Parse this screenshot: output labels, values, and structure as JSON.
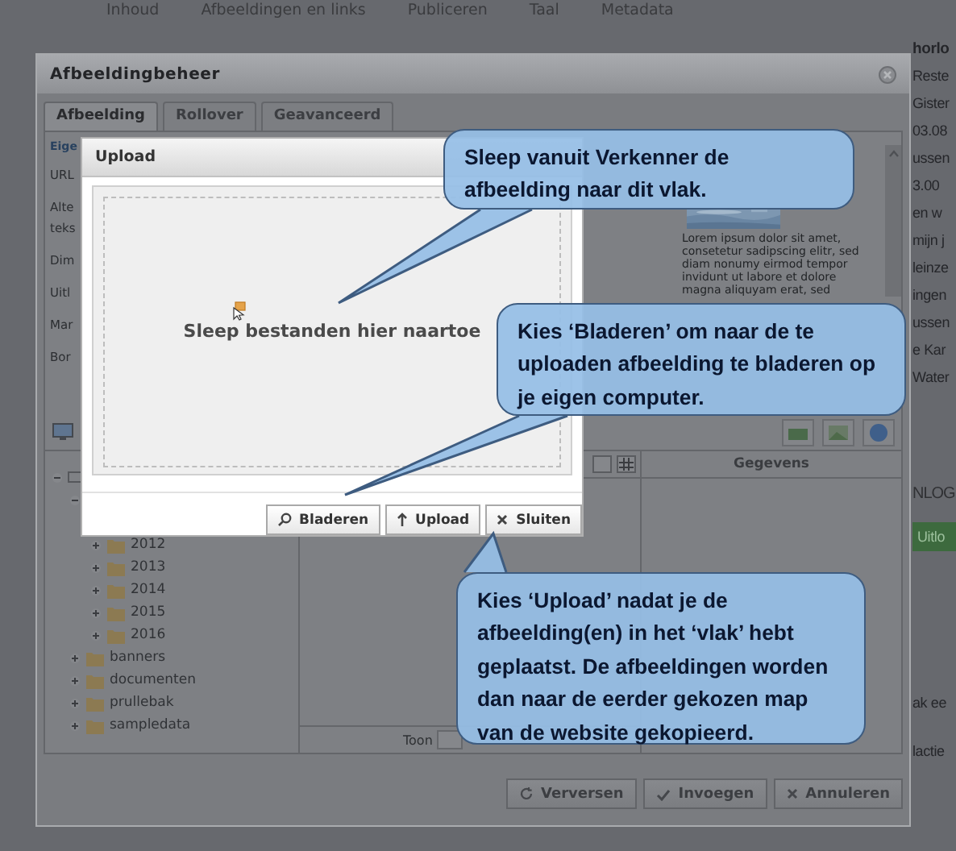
{
  "page": {
    "nav_tabs": [
      "Inhoud",
      "Afbeeldingen en links",
      "Publiceren",
      "Taal",
      "Metadata"
    ],
    "sidebar_lines": [
      "horlo",
      "Reste",
      "Gister",
      "03.08",
      "ussen",
      "3.00",
      "en w",
      "mijn j",
      "leinze",
      "ingen",
      "ussen",
      "e Kar",
      "Water"
    ],
    "login_heading": "NLOG",
    "logout_button": "Uitlo",
    "footer_lines": [
      "ak ee",
      "lactie"
    ]
  },
  "window": {
    "title": "Afbeeldingbeheer",
    "tabs": [
      {
        "label": "Afbeelding",
        "selected": true
      },
      {
        "label": "Rollover",
        "selected": false
      },
      {
        "label": "Geavanceerd",
        "selected": false
      }
    ],
    "section_heading": "Eige",
    "form_labels": [
      "URL",
      "Alte teks",
      "Dim",
      "Uitl",
      "Mar",
      "Bor"
    ],
    "preview": {
      "text": "Lorem ipsum dolor sit amet, consetetur sadipscing elitr, sed diam nonumy eirmod tempor invidunt ut labore et dolore magna aliquyam erat, sed"
    },
    "folder_tree": [
      {
        "expanded": true,
        "children": [
          {
            "expanded": true,
            "children": [
              {
                "label": "2012",
                "expanded": false
              },
              {
                "label": "2013",
                "expanded": false
              },
              {
                "label": "2014",
                "expanded": false
              },
              {
                "label": "2015",
                "expanded": false
              },
              {
                "label": "2016",
                "expanded": false
              }
            ]
          },
          {
            "label": "banners",
            "expanded": false
          },
          {
            "label": "documenten",
            "expanded": false
          },
          {
            "label": "prullebak",
            "expanded": false
          },
          {
            "label": "sampledata",
            "expanded": false
          }
        ]
      }
    ],
    "details_heading": "Gegevens",
    "pager_label": "Toon",
    "buttons": [
      "Verversen",
      "Invoegen",
      "Annuleren"
    ]
  },
  "upload_dialog": {
    "title": "Upload",
    "drop_text": "Sleep bestanden hier naartoe",
    "buttons": [
      "Bladeren",
      "Upload",
      "Sluiten"
    ]
  },
  "callouts": [
    {
      "text": "Sleep vanuit Verkenner de afbeelding naar dit vlak."
    },
    {
      "text": "Kies ‘Bladeren’ om naar de te uploaden afbeelding te bladeren op je eigen computer."
    },
    {
      "text": "Kies ‘Upload’ nadat je de afbeelding(en) in het ‘vlak’ hebt geplaatst. De afbeeldingen worden dan naar de eerder  gekozen map van de website gekopieerd."
    }
  ]
}
